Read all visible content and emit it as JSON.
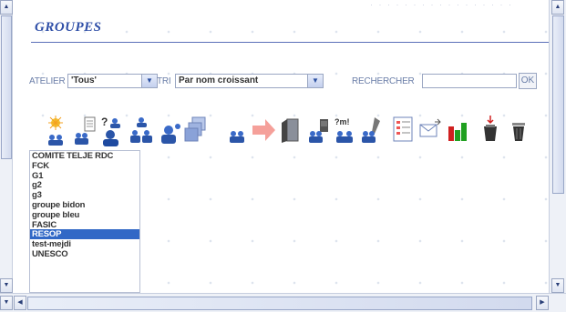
{
  "header": {
    "title": "GROUPES"
  },
  "filters": {
    "atelier_label": "ATELIER",
    "atelier_value": "'Tous'",
    "tri_label": "TRI",
    "tri_value": "Par nom croissant",
    "rechercher_label": "RECHERCHER",
    "search_value": "",
    "ok_label": "OK"
  },
  "toolbar": {
    "icons": [
      "new-group-icon",
      "group-properties-icon",
      "group-help-icon",
      "group-members-icon",
      "add-member-icon",
      "copy-group-icon",
      "group-icon",
      "arrow-right-icon",
      "exit-door-icon",
      "group-lock-icon",
      "group-message-icon",
      "group-edit-icon",
      "form-list-icon",
      "send-mail-icon",
      "bar-chart-icon",
      "delete-icon",
      "trash-icon"
    ]
  },
  "groups": {
    "items": [
      "COMITE TELJE RDC",
      "FCK",
      "G1",
      "g2",
      "g3",
      "groupe bidon",
      "groupe bleu",
      "FASIC",
      "RESOP",
      "test-mejdi",
      "UNESCO"
    ],
    "selected_index": 8
  },
  "colors": {
    "accent": "#3050a8",
    "selection": "#3168c6",
    "label": "#6a7ea8"
  }
}
